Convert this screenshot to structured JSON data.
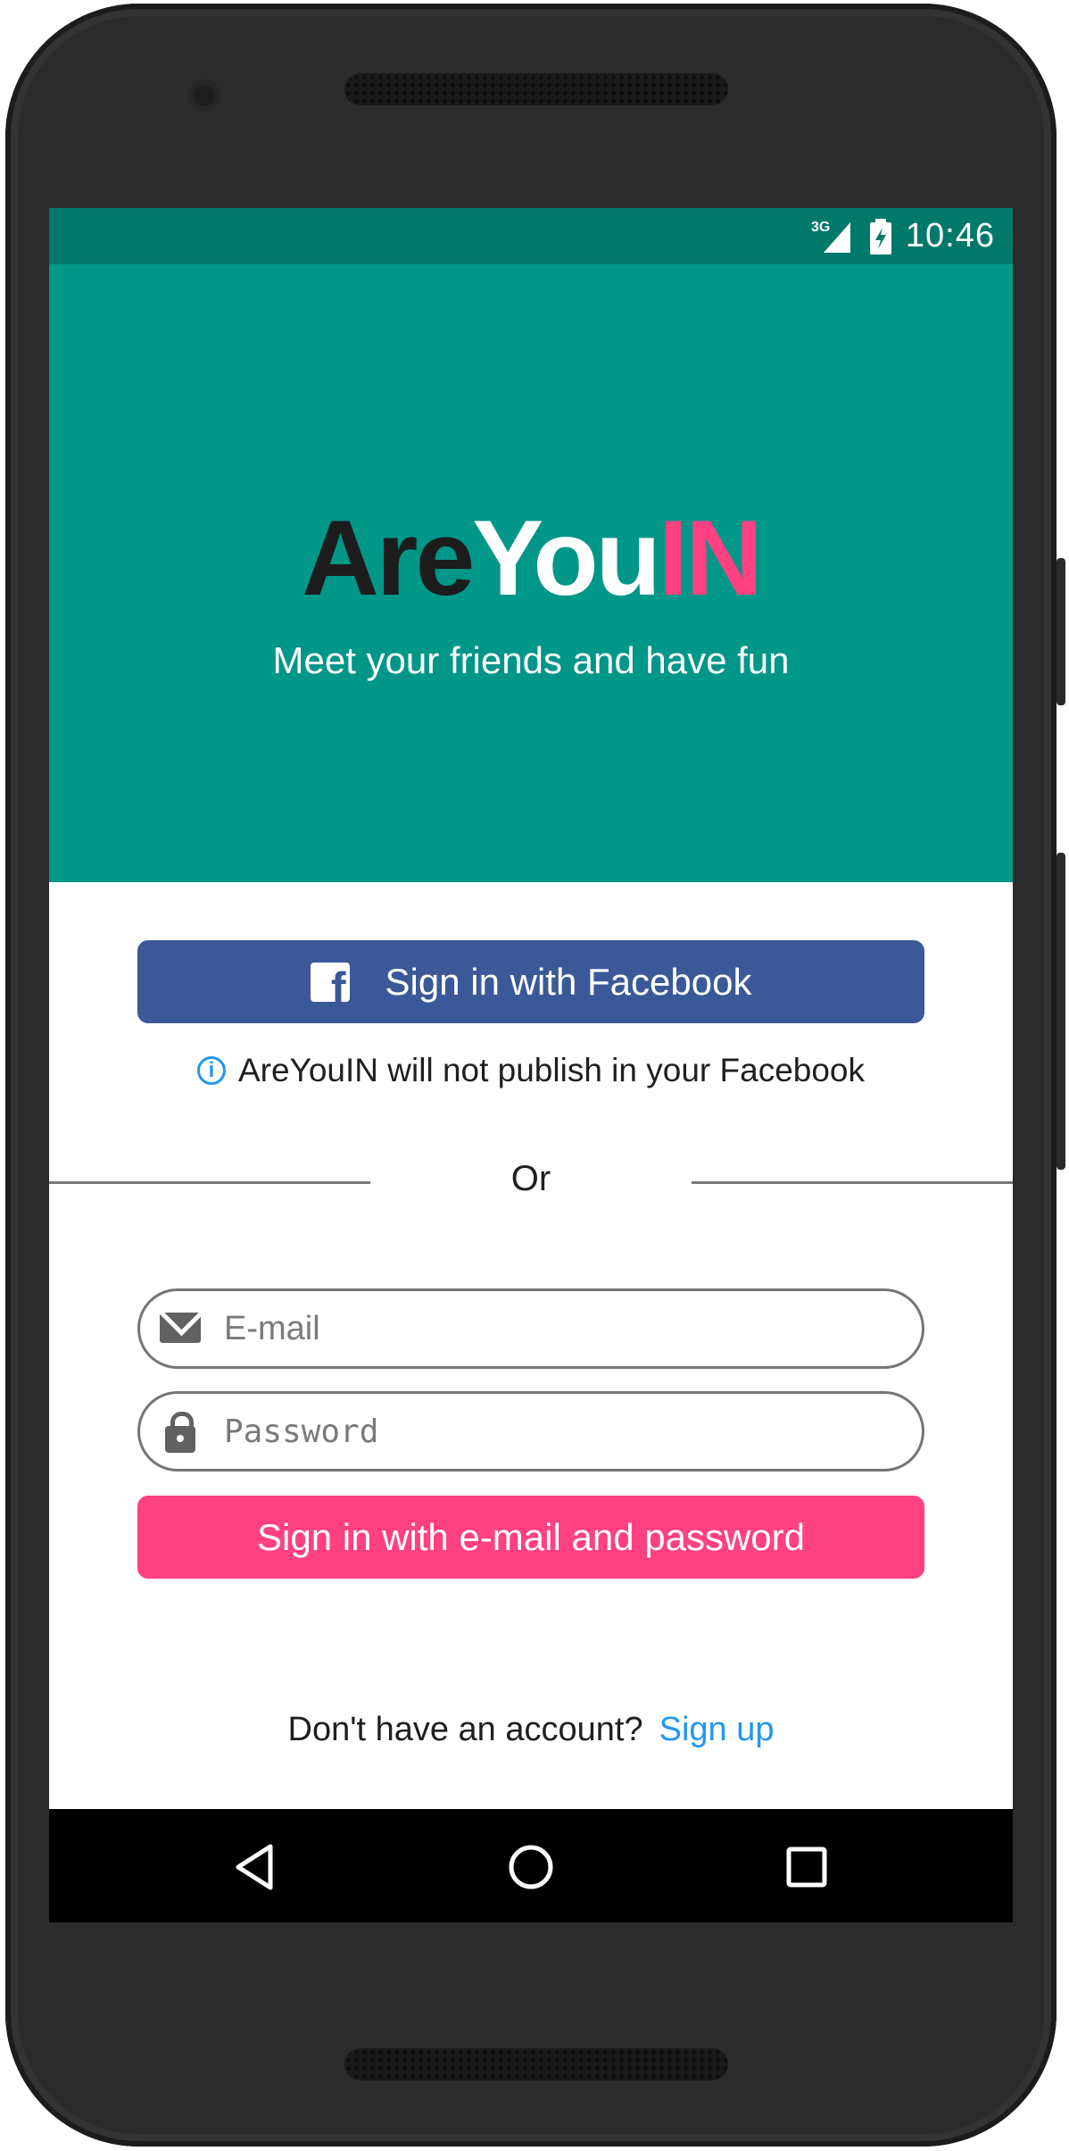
{
  "status_bar": {
    "network": "3G",
    "time": "10:46"
  },
  "hero": {
    "logo_part1": "Are",
    "logo_part2": "You",
    "logo_part3": "IN",
    "tagline": "Meet your friends and have fun"
  },
  "facebook": {
    "button_label": "Sign in with Facebook",
    "note": "AreYouIN will not publish in your Facebook"
  },
  "divider_text": "Or",
  "form": {
    "email_placeholder": "E-mail",
    "email_value": "",
    "password_placeholder": "Password",
    "password_value": "",
    "submit_label": "Sign in with e-mail and password"
  },
  "signup": {
    "prompt": "Don't have an account?",
    "link": "Sign up"
  },
  "colors": {
    "primary": "#009688",
    "primary_dark": "#00796b",
    "accent": "#ff4081",
    "facebook": "#3b5998",
    "link": "#2196f3"
  },
  "icons": [
    "facebook-icon",
    "info-icon",
    "mail-icon",
    "lock-icon",
    "back-icon",
    "home-icon",
    "recents-icon",
    "signal-icon",
    "battery-icon"
  ]
}
